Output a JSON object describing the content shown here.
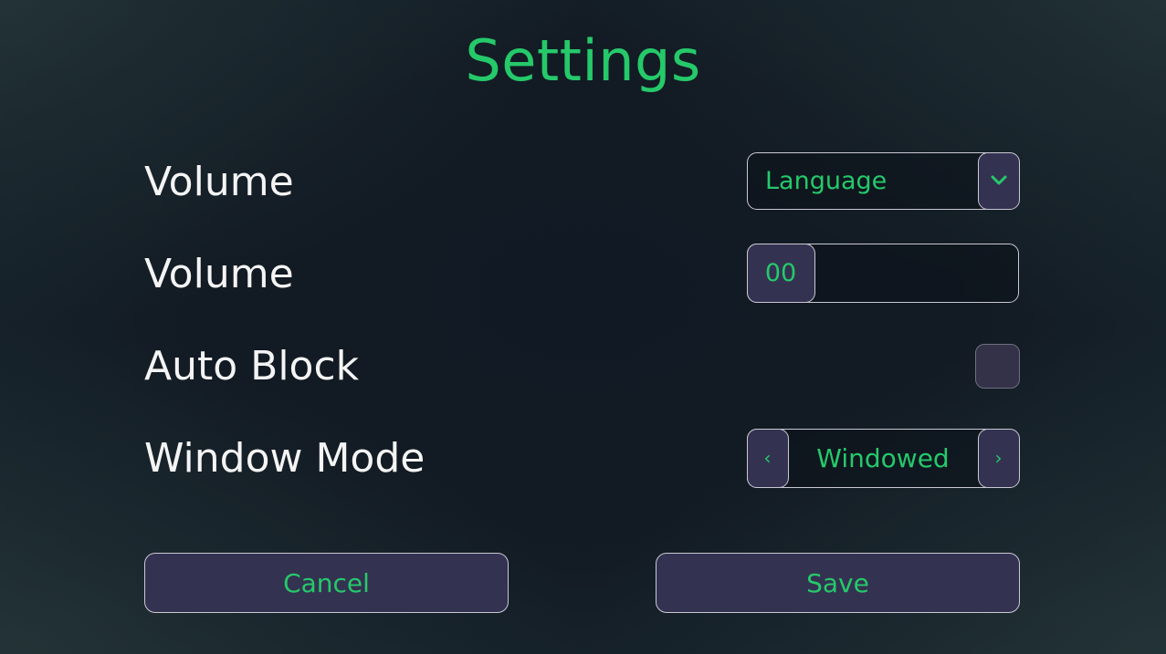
{
  "title": "Settings",
  "accent_color": "#25c96a",
  "rows": [
    {
      "label": "Volume",
      "control": "dropdown",
      "value": "Language",
      "icon": "chevron-down-icon"
    },
    {
      "label": "Volume",
      "control": "slider",
      "value": "00"
    },
    {
      "label": "Auto Block",
      "control": "checkbox",
      "checked": false
    },
    {
      "label": "Window Mode",
      "control": "stepper",
      "value": "Windowed",
      "prev_icon": "‹",
      "next_icon": "›"
    }
  ],
  "buttons": {
    "cancel": "Cancel",
    "save": "Save"
  }
}
